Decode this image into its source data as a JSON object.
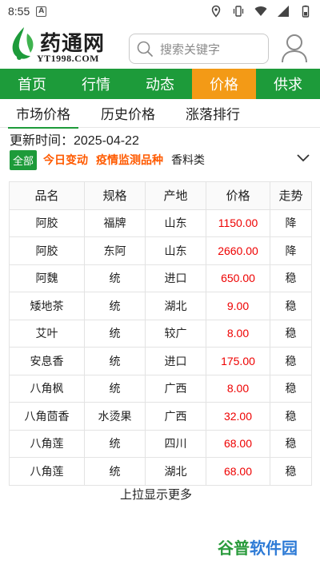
{
  "status_bar": {
    "time": "8:55",
    "app_badge": "A",
    "icons": [
      "location-icon",
      "vibrate-icon",
      "wifi-icon",
      "signal-icon",
      "battery-icon"
    ]
  },
  "header": {
    "logo_name": "药通网",
    "logo_url": "YT1998.COM",
    "search_placeholder": "搜索关键字"
  },
  "nav": {
    "items": [
      "首页",
      "行情",
      "动态",
      "价格",
      "供求"
    ],
    "active_index": 3
  },
  "subtabs": {
    "items": [
      "市场价格",
      "历史价格",
      "涨落排行"
    ],
    "active_index": 0
  },
  "updated": "更新时间：2025-04-22",
  "filters": {
    "all": "全部",
    "today_change": "今日变动",
    "epidemic": "疫情监测品种",
    "category": "香料类"
  },
  "table": {
    "headers": [
      "品名",
      "规格",
      "产地",
      "价格",
      "走势"
    ],
    "rows": [
      [
        "阿胶",
        "福牌",
        "山东",
        "1150.00",
        "降"
      ],
      [
        "阿胶",
        "东阿",
        "山东",
        "2660.00",
        "降"
      ],
      [
        "阿魏",
        "统",
        "进口",
        "650.00",
        "稳"
      ],
      [
        "矮地茶",
        "统",
        "湖北",
        "9.00",
        "稳"
      ],
      [
        "艾叶",
        "统",
        "较广",
        "8.00",
        "稳"
      ],
      [
        "安息香",
        "统",
        "进口",
        "175.00",
        "稳"
      ],
      [
        "八角枫",
        "统",
        "广西",
        "8.00",
        "稳"
      ],
      [
        "八角茴香",
        "水烫果",
        "广西",
        "32.00",
        "稳"
      ],
      [
        "八角莲",
        "统",
        "四川",
        "68.00",
        "稳"
      ],
      [
        "八角莲",
        "统",
        "湖北",
        "68.00",
        "稳"
      ]
    ]
  },
  "more": "上拉显示更多",
  "watermark": {
    "part1": "谷普",
    "part2": "软件园"
  },
  "colors": {
    "brand_green": "#1d9b3a",
    "active_orange": "#f39a16",
    "price_red": "#e00000",
    "filter_orange": "#ff5a00"
  }
}
